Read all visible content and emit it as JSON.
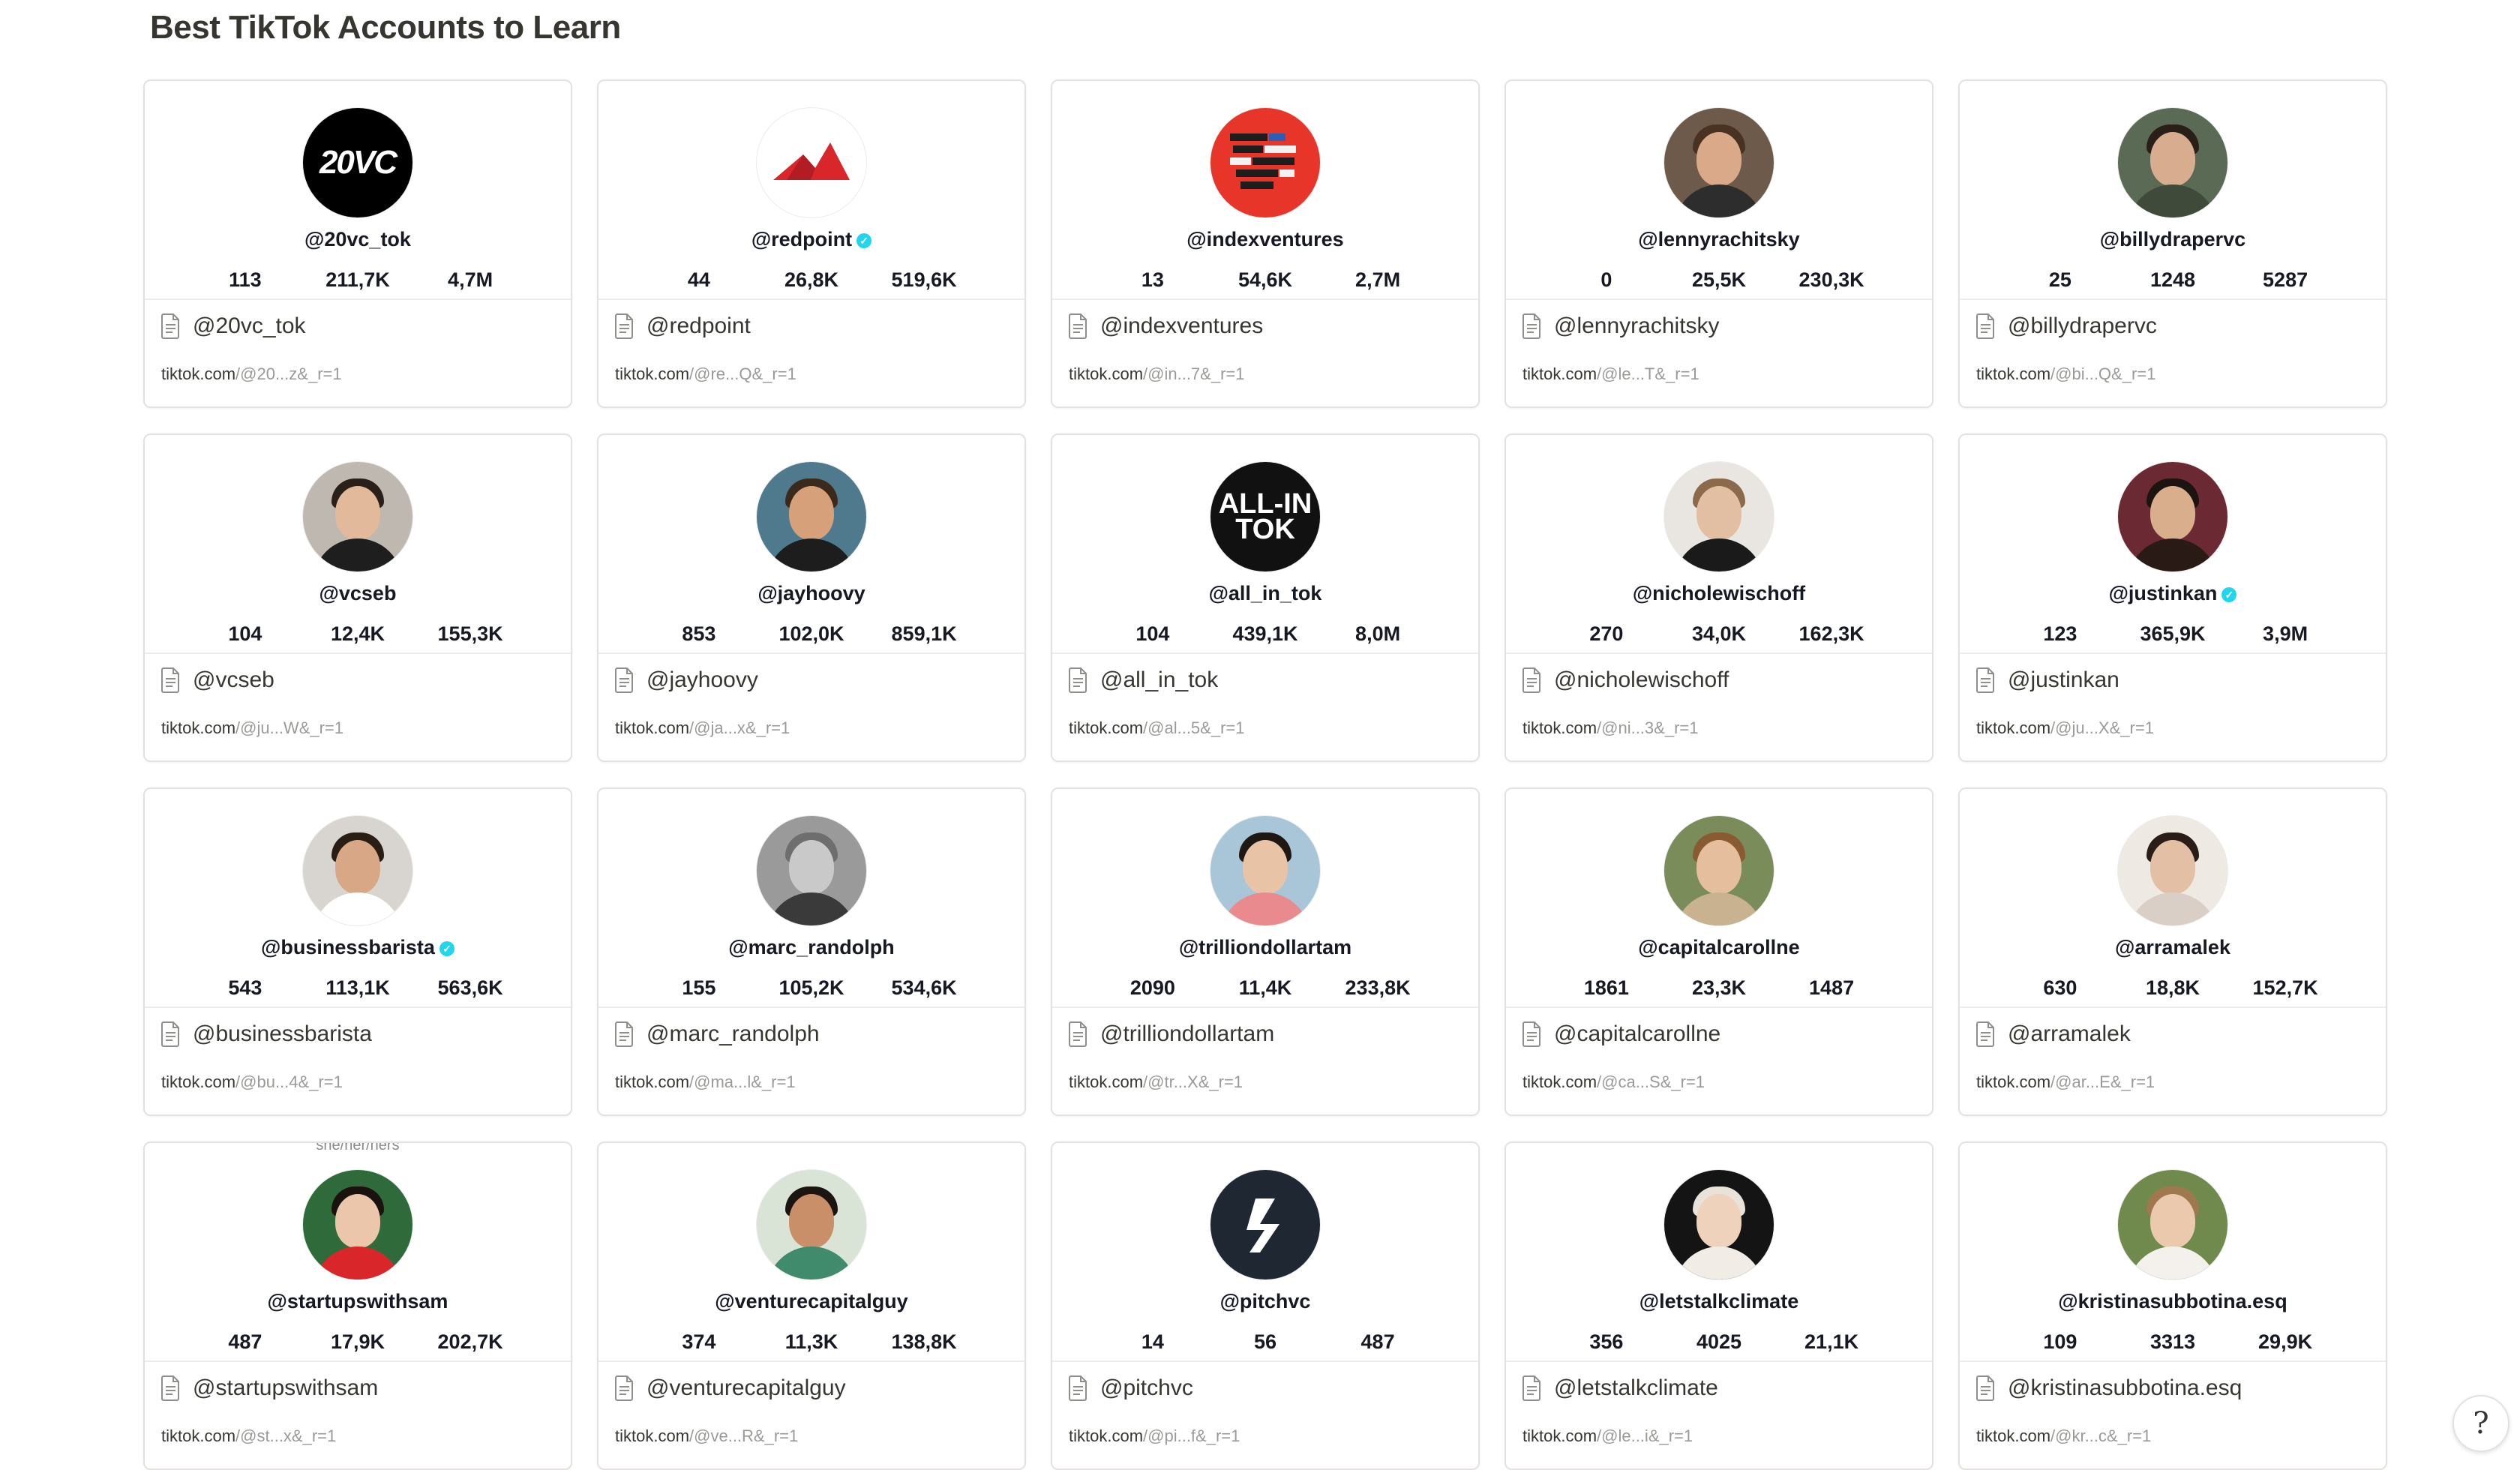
{
  "page": {
    "title": "Best TikTok Accounts to Learn",
    "help_icon": "?"
  },
  "colors": {
    "card_border": "#e3e2df",
    "text": "#37352f",
    "muted": "#9b9a97",
    "verified": "#20d5ec"
  },
  "cards": [
    {
      "handle": "@20vc_tok",
      "title": "@20vc_tok",
      "url_domain": "tiktok.com",
      "url_path": "/@20...z&_r=1",
      "following": "113",
      "followers": "211,7K",
      "likes": "4,7M",
      "verified": false,
      "pronouns": "",
      "avatar": {
        "type": "logo",
        "text": "20VC",
        "bg": "#000000"
      }
    },
    {
      "handle": "@redpoint",
      "title": "@redpoint",
      "url_domain": "tiktok.com",
      "url_path": "/@re...Q&_r=1",
      "following": "44",
      "followers": "26,8K",
      "likes": "519,6K",
      "verified": true,
      "pronouns": "",
      "avatar": {
        "type": "redpoint",
        "bg": "#ffffff"
      }
    },
    {
      "handle": "@indexventures",
      "title": "@indexventures",
      "url_domain": "tiktok.com",
      "url_path": "/@in...7&_r=1",
      "following": "13",
      "followers": "54,6K",
      "likes": "2,7M",
      "verified": false,
      "pronouns": "",
      "avatar": {
        "type": "index",
        "bg": "#e8352a"
      }
    },
    {
      "handle": "@lennyrachitsky",
      "title": "@lennyrachitsky",
      "url_domain": "tiktok.com",
      "url_path": "/@le...T&_r=1",
      "following": "0",
      "followers": "25,5K",
      "likes": "230,3K",
      "verified": false,
      "pronouns": "",
      "avatar": {
        "type": "photo",
        "bg": "#6d5a4a",
        "skin": "#d9a98a",
        "hair": "#4a3222",
        "shirt": "#2d2d2d"
      }
    },
    {
      "handle": "@billydrapervc",
      "title": "@billydrapervc",
      "url_domain": "tiktok.com",
      "url_path": "/@bi...Q&_r=1",
      "following": "25",
      "followers": "1248",
      "likes": "5287",
      "verified": false,
      "pronouns": "",
      "avatar": {
        "type": "photo",
        "bg": "#5b6a55",
        "skin": "#d8ad8f",
        "hair": "#2a1f18",
        "shirt": "#3f4a3a"
      }
    },
    {
      "handle": "@vcseb",
      "title": "@vcseb",
      "url_domain": "tiktok.com",
      "url_path": "/@ju...W&_r=1",
      "following": "104",
      "followers": "12,4K",
      "likes": "155,3K",
      "verified": false,
      "pronouns": "",
      "avatar": {
        "type": "photo",
        "bg": "#bfb8b0",
        "skin": "#e2b99a",
        "hair": "#2b2019",
        "shirt": "#1e1e1e"
      }
    },
    {
      "handle": "@jayhoovy",
      "title": "@jayhoovy",
      "url_domain": "tiktok.com",
      "url_path": "/@ja...x&_r=1",
      "following": "853",
      "followers": "102,0K",
      "likes": "859,1K",
      "verified": false,
      "pronouns": "",
      "avatar": {
        "type": "photo",
        "bg": "#4f7a8d",
        "skin": "#d6a07a",
        "hair": "#3b2a1c",
        "shirt": "#1d1d1d"
      }
    },
    {
      "handle": "@all_in_tok",
      "title": "@all_in_tok",
      "url_domain": "tiktok.com",
      "url_path": "/@al...5&_r=1",
      "following": "104",
      "followers": "439,1K",
      "likes": "8,0M",
      "verified": false,
      "pronouns": "",
      "avatar": {
        "type": "allin",
        "text1": "ALL-IN",
        "text2": "TOK",
        "bg": "#111111"
      }
    },
    {
      "handle": "@nicholewischoff",
      "title": "@nicholewischoff",
      "url_domain": "tiktok.com",
      "url_path": "/@ni...3&_r=1",
      "following": "270",
      "followers": "34,0K",
      "likes": "162,3K",
      "verified": false,
      "pronouns": "",
      "avatar": {
        "type": "photo",
        "bg": "#e9e6e2",
        "skin": "#e2bfa3",
        "hair": "#8b6a4c",
        "shirt": "#1a1a1a"
      }
    },
    {
      "handle": "@justinkan",
      "title": "@justinkan",
      "url_domain": "tiktok.com",
      "url_path": "/@ju...X&_r=1",
      "following": "123",
      "followers": "365,9K",
      "likes": "3,9M",
      "verified": true,
      "pronouns": "",
      "avatar": {
        "type": "photo",
        "bg": "#6b2a33",
        "skin": "#d9ae8c",
        "hair": "#1b1410",
        "shirt": "#2a1a16"
      }
    },
    {
      "handle": "@businessbarista",
      "title": "@businessbarista",
      "url_domain": "tiktok.com",
      "url_path": "/@bu...4&_r=1",
      "following": "543",
      "followers": "113,1K",
      "likes": "563,6K",
      "verified": true,
      "pronouns": "",
      "avatar": {
        "type": "photo",
        "bg": "#d8d4cf",
        "skin": "#d8a886",
        "hair": "#2a1d14",
        "shirt": "#ffffff"
      }
    },
    {
      "handle": "@marc_randolph",
      "title": "@marc_randolph",
      "url_domain": "tiktok.com",
      "url_path": "/@ma...l&_r=1",
      "following": "155",
      "followers": "105,2K",
      "likes": "534,6K",
      "verified": false,
      "pronouns": "",
      "avatar": {
        "type": "photo",
        "bg": "#9a9a9a",
        "skin": "#c9c9c9",
        "hair": "#6e6e6e",
        "shirt": "#3a3a3a"
      }
    },
    {
      "handle": "@trilliondollartam",
      "title": "@trilliondollartam",
      "url_domain": "tiktok.com",
      "url_path": "/@tr...X&_r=1",
      "following": "2090",
      "followers": "11,4K",
      "likes": "233,8K",
      "verified": false,
      "pronouns": "",
      "avatar": {
        "type": "photo",
        "bg": "#a9c6d8",
        "skin": "#e9c3a6",
        "hair": "#1f1712",
        "shirt": "#e98a8f"
      }
    },
    {
      "handle": "@capitalcarollne",
      "title": "@capitalcarollne",
      "url_domain": "tiktok.com",
      "url_path": "/@ca...S&_r=1",
      "following": "1861",
      "followers": "23,3K",
      "likes": "1487",
      "verified": false,
      "pronouns": "",
      "avatar": {
        "type": "photo",
        "bg": "#7a8c5a",
        "skin": "#e5bf9d",
        "hair": "#8a5a32",
        "shirt": "#c9b28f"
      }
    },
    {
      "handle": "@arramalek",
      "title": "@arramalek",
      "url_domain": "tiktok.com",
      "url_path": "/@ar...E&_r=1",
      "following": "630",
      "followers": "18,8K",
      "likes": "152,7K",
      "verified": false,
      "pronouns": "",
      "avatar": {
        "type": "photo",
        "bg": "#efe9e4",
        "skin": "#e3bfa5",
        "hair": "#2a1c16",
        "shirt": "#d9cfc7"
      }
    },
    {
      "handle": "@startupswithsam",
      "title": "@startupswithsam",
      "url_domain": "tiktok.com",
      "url_path": "/@st...x&_r=1",
      "following": "487",
      "followers": "17,9K",
      "likes": "202,7K",
      "verified": false,
      "pronouns": "she/her/hers",
      "avatar": {
        "type": "photo",
        "bg": "#2f6b3a",
        "skin": "#ecc6aa",
        "hair": "#1a120e",
        "shirt": "#d8262b"
      }
    },
    {
      "handle": "@venturecapitalguy",
      "title": "@venturecapitalguy",
      "url_domain": "tiktok.com",
      "url_path": "/@ve...R&_r=1",
      "following": "374",
      "followers": "11,3K",
      "likes": "138,8K",
      "verified": false,
      "pronouns": "",
      "avatar": {
        "type": "photo",
        "bg": "#d9e4d6",
        "skin": "#c98f68",
        "hair": "#1c1410",
        "shirt": "#3f8b6b"
      }
    },
    {
      "handle": "@pitchvc",
      "title": "@pitchvc",
      "url_domain": "tiktok.com",
      "url_path": "/@pi...f&_r=1",
      "following": "14",
      "followers": "56",
      "likes": "487",
      "verified": false,
      "pronouns": "",
      "avatar": {
        "type": "pitch",
        "bg": "#1f2733"
      }
    },
    {
      "handle": "@letstalkclimate",
      "title": "@letstalkclimate",
      "url_domain": "tiktok.com",
      "url_path": "/@le...i&_r=1",
      "following": "356",
      "followers": "4025",
      "likes": "21,1K",
      "verified": false,
      "pronouns": "",
      "avatar": {
        "type": "photo",
        "bg": "#141414",
        "skin": "#efd2bb",
        "hair": "#e8e2d8",
        "shirt": "#f1ede6"
      }
    },
    {
      "handle": "@kristinasubbotina.esq",
      "title": "@kristinasubbotina.esq",
      "url_domain": "tiktok.com",
      "url_path": "/@kr...c&_r=1",
      "following": "109",
      "followers": "3313",
      "likes": "29,9K",
      "verified": false,
      "pronouns": "",
      "avatar": {
        "type": "photo",
        "bg": "#6f8a4c",
        "skin": "#ebc9ad",
        "hair": "#a07850",
        "shirt": "#f4f1ec"
      }
    }
  ]
}
